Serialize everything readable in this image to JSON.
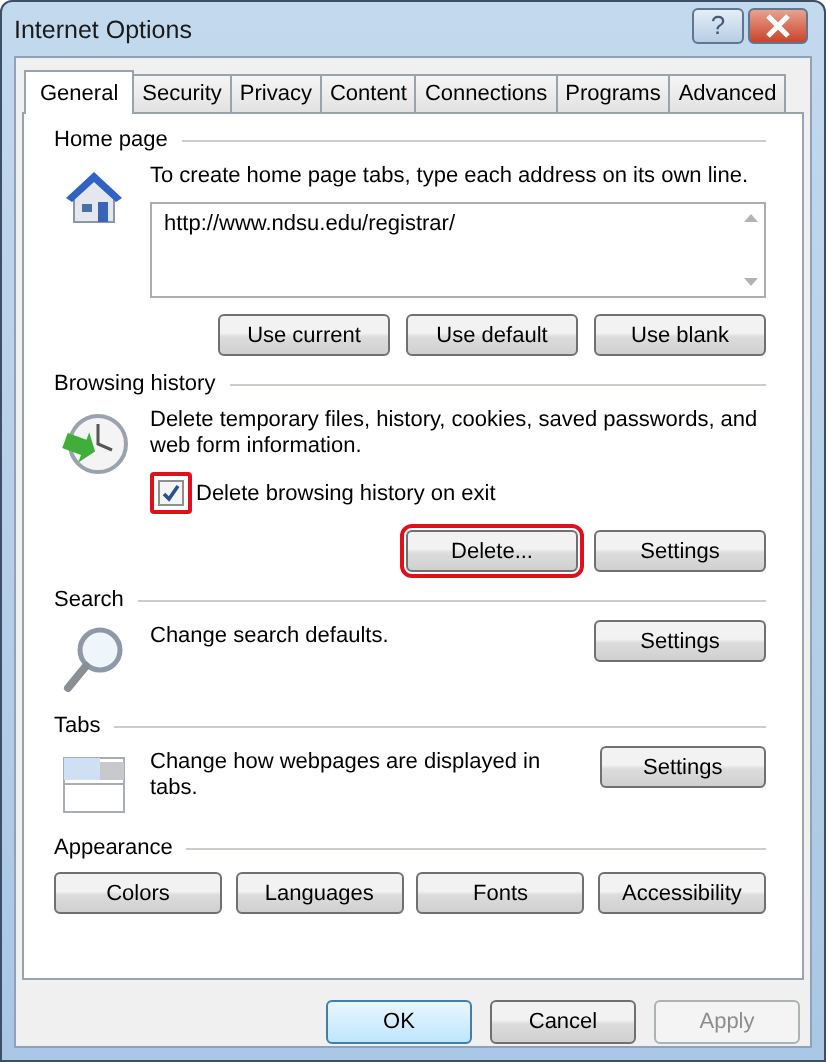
{
  "window": {
    "title": "Internet Options",
    "help_label": "?"
  },
  "tabs": [
    {
      "label": "General",
      "selected": true
    },
    {
      "label": "Security",
      "selected": false
    },
    {
      "label": "Privacy",
      "selected": false
    },
    {
      "label": "Content",
      "selected": false
    },
    {
      "label": "Connections",
      "selected": false
    },
    {
      "label": "Programs",
      "selected": false
    },
    {
      "label": "Advanced",
      "selected": false
    }
  ],
  "sections": [
    {
      "kind": "house",
      "heading": "Home page",
      "description": "To create home page tabs, type each address on its own line.",
      "field_value": "http://www.ndsu.edu/registrar/",
      "buttons": [
        {
          "label": "Use current",
          "highlighted": false
        },
        {
          "label": "Use default",
          "highlighted": false
        },
        {
          "label": "Use blank",
          "highlighted": false
        }
      ]
    },
    {
      "kind": "clock",
      "heading": "Browsing history",
      "description": "Delete temporary files, history, cookies, saved passwords, and web form information.",
      "checkbox": {
        "label": "Delete browsing history on exit",
        "checked": true,
        "highlighted": true
      },
      "buttons": [
        {
          "label": "Delete...",
          "highlighted": true
        },
        {
          "label": "Settings",
          "highlighted": false
        }
      ]
    },
    {
      "kind": "magnifier",
      "heading": "Search",
      "description": "Change search defaults.",
      "side_button": {
        "label": "Settings",
        "highlighted": false
      }
    },
    {
      "kind": "tabs",
      "heading": "Tabs",
      "description": "Change how webpages are displayed in tabs.",
      "side_button": {
        "label": "Settings",
        "highlighted": false
      }
    },
    {
      "kind": "none",
      "heading": "Appearance",
      "wide_buttons": [
        {
          "label": "Colors",
          "highlighted": false
        },
        {
          "label": "Languages",
          "highlighted": false
        },
        {
          "label": "Fonts",
          "highlighted": false
        },
        {
          "label": "Accessibility",
          "highlighted": false
        }
      ]
    }
  ],
  "footer_buttons": [
    {
      "label": "OK",
      "default": true,
      "disabled": false
    },
    {
      "label": "Cancel",
      "default": false,
      "disabled": false
    },
    {
      "label": "Apply",
      "default": false,
      "disabled": true
    }
  ]
}
